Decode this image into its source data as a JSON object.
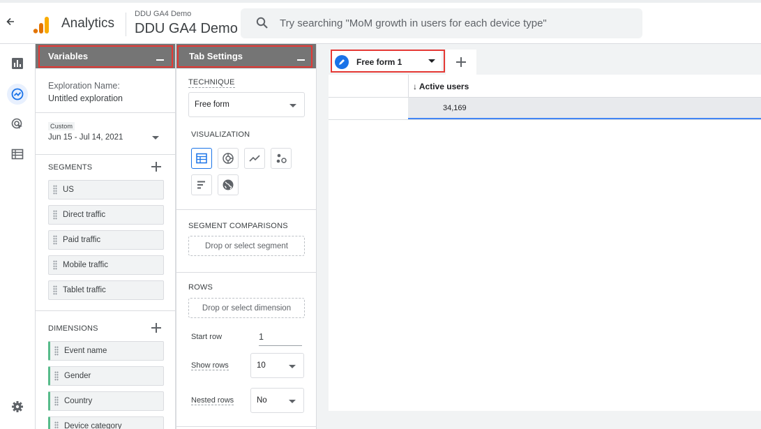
{
  "topbar": {
    "app_name": "Analytics",
    "account_small": "DDU GA4 Demo",
    "account_big": "DDU GA4 Demo",
    "search_placeholder": "Try searching \"MoM growth in users for each device type\""
  },
  "colors": {
    "accent": "#1a73e8",
    "highlight": "#e53935",
    "panel_header": "#757575",
    "dimension_chip": "#57bb8a"
  },
  "left_nav": {
    "icons": [
      "reports-icon",
      "explore-icon",
      "advertising-icon",
      "configure-icon",
      "settings-icon"
    ],
    "active": "explore-icon"
  },
  "variables_panel": {
    "title": "Variables",
    "exploration_name_label": "Exploration Name:",
    "exploration_name_value": "Untitled exploration",
    "date_tag": "Custom",
    "date_range": "Jun 15 - Jul 14, 2021",
    "segments_title": "SEGMENTS",
    "segments": [
      "US",
      "Direct traffic",
      "Paid traffic",
      "Mobile traffic",
      "Tablet traffic"
    ],
    "dimensions_title": "DIMENSIONS",
    "dimensions": [
      "Event name",
      "Gender",
      "Country",
      "Device category"
    ]
  },
  "tab_settings": {
    "title": "Tab Settings",
    "technique_label": "TECHNIQUE",
    "technique_value": "Free form",
    "visualization_label": "VISUALIZATION",
    "visualizations": [
      "table-icon",
      "donut-chart-icon",
      "line-chart-icon",
      "scatter-plot-icon",
      "bar-chart-icon",
      "geo-map-icon"
    ],
    "selected_visualization": "table-icon",
    "segment_comparisons_label": "SEGMENT COMPARISONS",
    "segment_drop": "Drop or select segment",
    "rows_label": "ROWS",
    "dimension_drop": "Drop or select dimension",
    "start_row_label": "Start row",
    "start_row_value": "1",
    "show_rows_label": "Show rows",
    "show_rows_value": "10",
    "nested_rows_label": "Nested rows",
    "nested_rows_value": "No"
  },
  "canvas": {
    "tab_label": "Free form 1",
    "column_header": "Active users",
    "sort_indicator": "↓",
    "total_value": "34,169"
  }
}
